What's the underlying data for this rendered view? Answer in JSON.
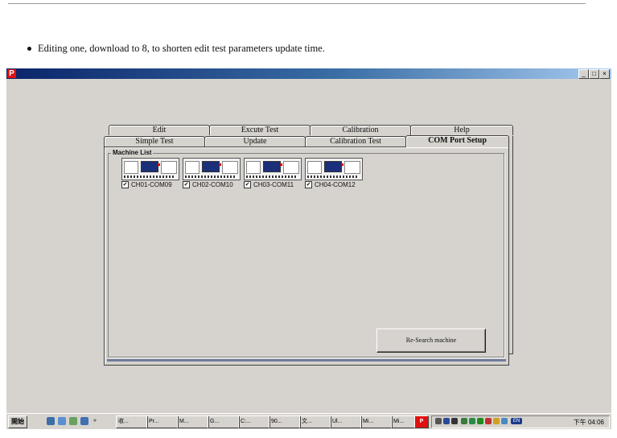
{
  "bullet_text": "Editing one, download to 8, to shorten edit test parameters update time.",
  "app": {
    "icon_letter": "P",
    "window_buttons": [
      "_",
      "□",
      "×"
    ]
  },
  "tabs": {
    "row1": [
      "Edit",
      "Excute Test",
      "Calibration",
      "Help"
    ],
    "row2": [
      "Simple Test",
      "Update",
      "Calibration Test",
      "COM Port Setup"
    ],
    "active": "COM Port Setup"
  },
  "machine_list": {
    "title": "Machine List",
    "items": [
      {
        "label": "CH01-COM09",
        "checked": true
      },
      {
        "label": "CH02-COM10",
        "checked": true
      },
      {
        "label": "CH03-COM11",
        "checked": true
      },
      {
        "label": "CH04-COM12",
        "checked": true
      }
    ]
  },
  "research_button": "Re-Search machine",
  "taskbar": {
    "start": "開始",
    "quick_launch_more": "»",
    "buttons": [
      "收...",
      "Pr...",
      "M...",
      "G...",
      "C:...",
      "90...",
      "文...",
      "Ul...",
      "Mi...",
      "Mi..."
    ],
    "active_icon": "P",
    "ime": "EN",
    "clock": "下午 04:06"
  },
  "colors": {
    "titlebar_start": "#0a246a",
    "titlebar_end": "#a6caf0",
    "background": "#d6d3ce"
  }
}
